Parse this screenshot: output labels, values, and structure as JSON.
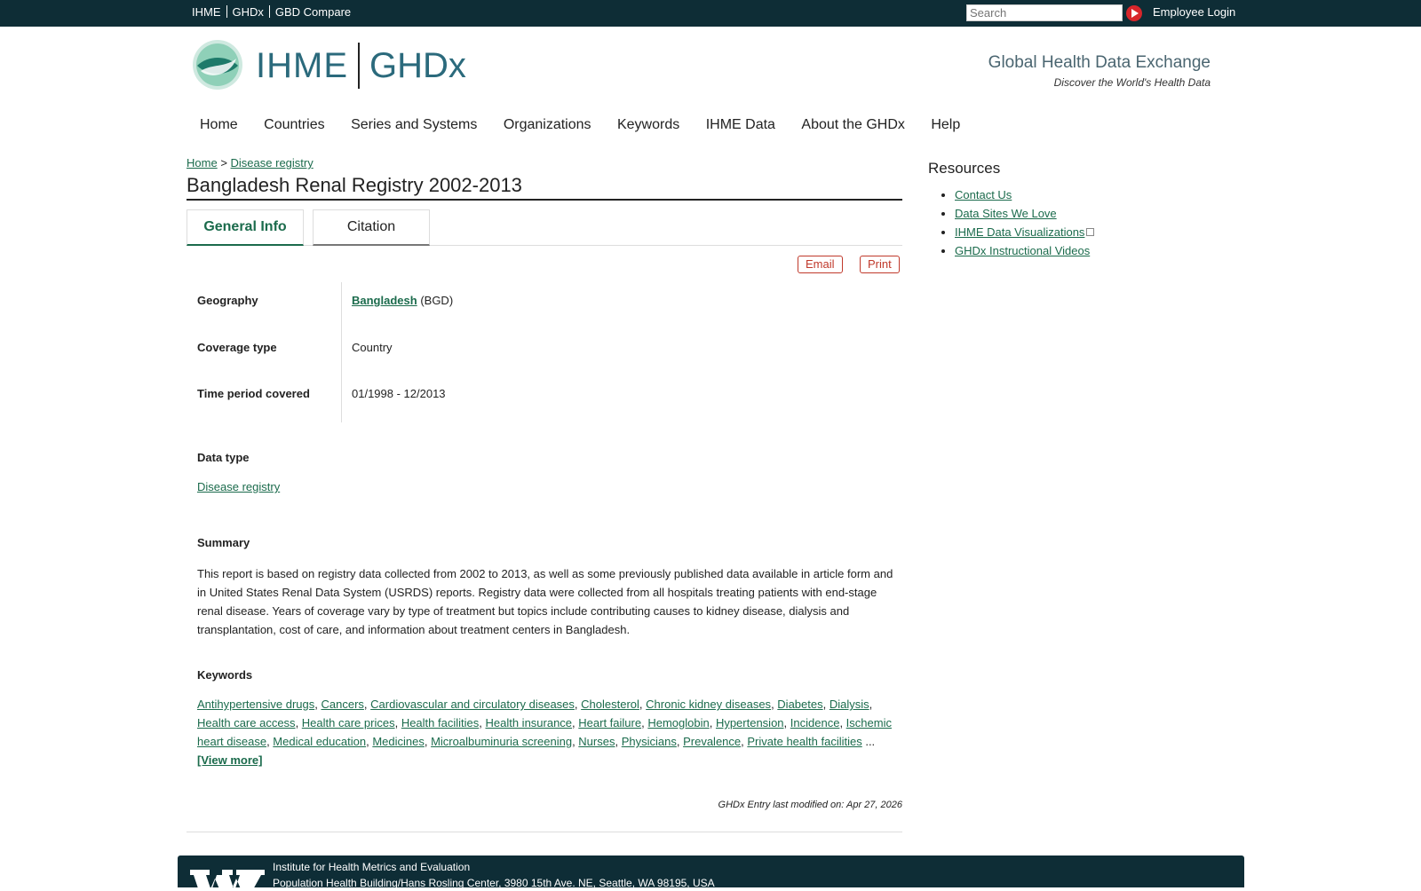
{
  "topbar": {
    "links": [
      "IHME",
      "GHDx",
      "GBD Compare"
    ],
    "search_placeholder": "Search",
    "login": "Employee Login"
  },
  "header": {
    "logo_left": "IHME",
    "logo_right": "GHDx",
    "tagline": "Global Health Data Exchange",
    "subtagline": "Discover the World's Health Data"
  },
  "nav": [
    "Home",
    "Countries",
    "Series and Systems",
    "Organizations",
    "Keywords",
    "IHME Data",
    "About the GHDx",
    "Help"
  ],
  "breadcrumb": {
    "home": "Home",
    "sep": ">",
    "current": "Disease registry"
  },
  "title": "Bangladesh Renal Registry 2002-2013",
  "tabs": {
    "general": "General Info",
    "citation": "Citation"
  },
  "actions": {
    "email": "Email",
    "print": "Print"
  },
  "info": {
    "geography_label": "Geography",
    "geography_link": "Bangladesh",
    "geography_code": "(BGD)",
    "coverage_label": "Coverage type",
    "coverage_value": "Country",
    "time_label": "Time period covered",
    "time_value": "01/1998 - 12/2013"
  },
  "data_type": {
    "label": "Data type",
    "value": "Disease registry"
  },
  "summary": {
    "label": "Summary",
    "text": "This report is based on registry data collected from 2002 to 2013, as well as some previously published data available in article form and in United States Renal Data System (USRDS) reports. Registry data were collected from all hospitals treating patients with end-stage renal disease. Years of coverage vary by type of treatment but topics include contributing causes to kidney disease, dialysis and transplantation, cost of care, and information about treatment centers in Bangladesh."
  },
  "keywords": {
    "label": "Keywords",
    "items": [
      "Antihypertensive drugs",
      "Cancers",
      "Cardiovascular and circulatory diseases",
      "Cholesterol",
      "Chronic kidney diseases",
      "Diabetes",
      "Dialysis",
      "Health care access",
      "Health care prices",
      "Health facilities",
      "Health insurance",
      "Heart failure",
      "Hemoglobin",
      "Hypertension",
      "Incidence",
      "Ischemic heart disease",
      "Medical education",
      "Medicines",
      "Microalbuminuria screening",
      "Nurses",
      "Physicians",
      "Prevalence",
      "Private health facilities"
    ],
    "ellipsis": "...",
    "view_more": "[View more]"
  },
  "modified": "GHDx Entry last modified on: Apr 27, 2026",
  "resources": {
    "title": "Resources",
    "links": [
      "Contact Us",
      "Data Sites We Love",
      "IHME Data Visualizations",
      "GHDx Instructional Videos"
    ]
  },
  "footer": {
    "line1": "Institute for Health Metrics and Evaluation",
    "line2": "Population Health Building/Hans Rosling Center, 3980 15th Ave. NE, Seattle, WA 98195, USA"
  },
  "colors": {
    "topbar": "#0e2d36",
    "link": "#1b6b4c",
    "accent_red": "#c0392b",
    "logo_teal": "#2b6a7c"
  }
}
